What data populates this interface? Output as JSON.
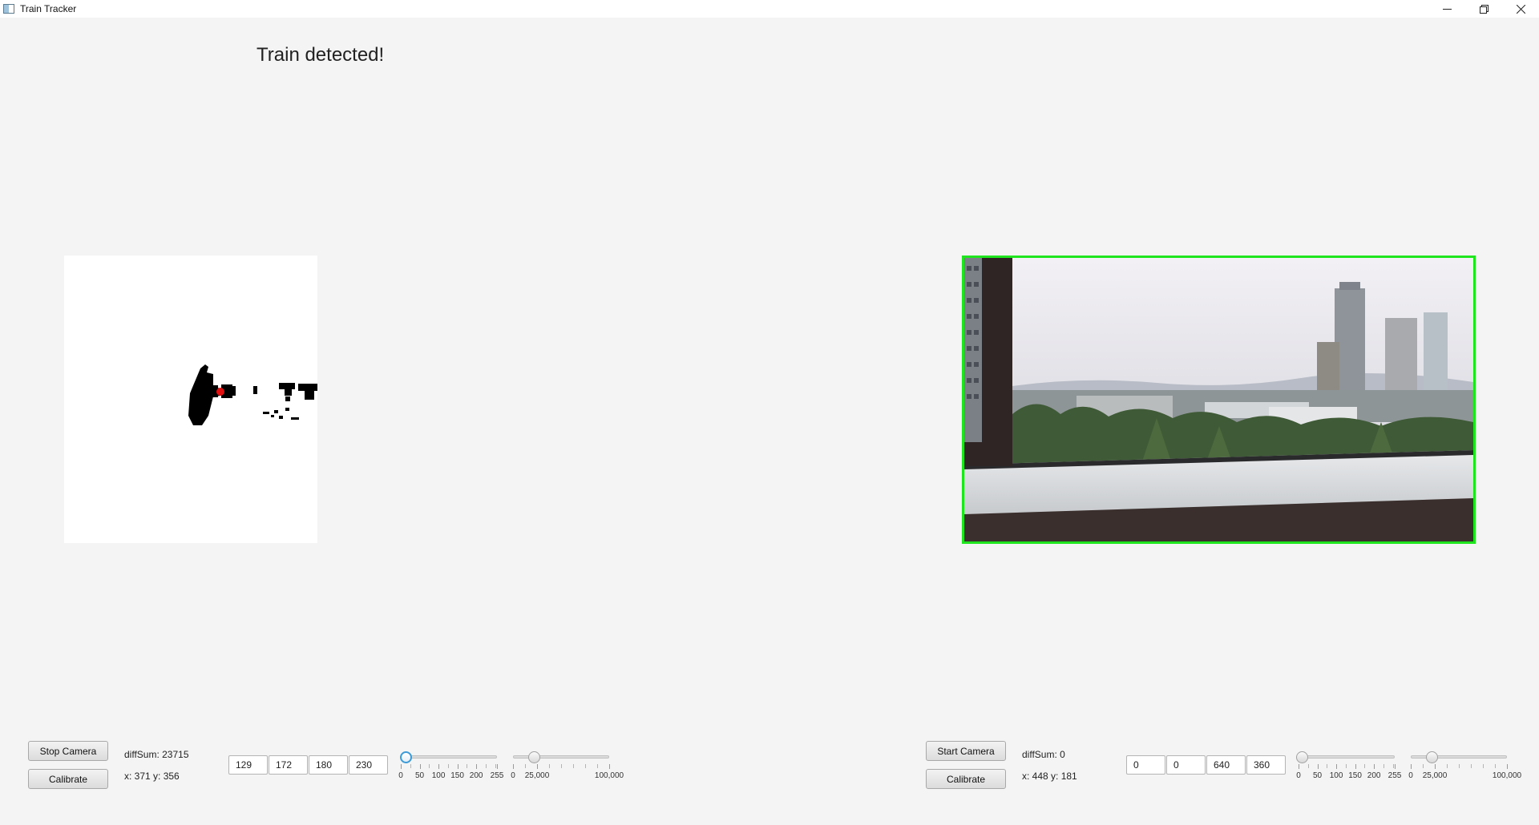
{
  "window": {
    "title": "Train Tracker",
    "controls": {
      "minimize_icon": "minimize-icon",
      "restore_icon": "restore-icon",
      "close_icon": "close-icon"
    }
  },
  "headline": "Train detected!",
  "accent_colors": {
    "detection_border": "#1ee51e",
    "marker": "#e01010",
    "slider_focus": "#3c9ad6"
  },
  "left_panel": {
    "camera_button": "Stop Camera",
    "calibrate_button": "Calibrate",
    "diff_sum": "diffSum: 23715",
    "coords": "x: 371 y: 356",
    "roi_fields": [
      "129",
      "172",
      "180",
      "230"
    ],
    "threshold_slider": {
      "value": 12,
      "min": 0,
      "max": 255,
      "tick_labels": [
        "0",
        "50",
        "100",
        "150",
        "200",
        "255"
      ]
    },
    "diff_slider": {
      "value": 22000,
      "min": 0,
      "max": 100000,
      "tick_labels": [
        "0",
        "25,000",
        "100,000"
      ]
    }
  },
  "right_panel": {
    "camera_button": "Start Camera",
    "calibrate_button": "Calibrate",
    "diff_sum": "diffSum: 0",
    "coords": "x: 448 y: 181",
    "roi_fields": [
      "0",
      "0",
      "640",
      "360"
    ],
    "threshold_slider": {
      "value": 8,
      "min": 0,
      "max": 255,
      "tick_labels": [
        "0",
        "50",
        "100",
        "150",
        "200",
        "255"
      ]
    },
    "diff_slider": {
      "value": 22000,
      "min": 0,
      "max": 100000,
      "tick_labels": [
        "0",
        "25,000",
        "100,000"
      ]
    }
  }
}
